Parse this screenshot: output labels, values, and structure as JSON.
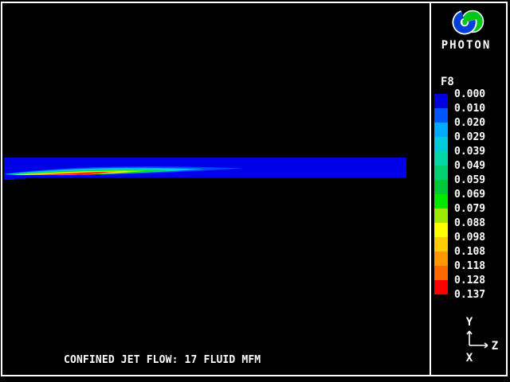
{
  "window": {
    "background": "#000000",
    "frame_color": "#ffffff"
  },
  "main": {
    "caption": "CONFINED JET FLOW: 17 FLUID MFM",
    "flow_bar": {
      "background": "#0000e8",
      "plume_layers": [
        "#0044ff",
        "#00aaff",
        "#00d0d8",
        "#00dda8",
        "#00cc44",
        "#00e800",
        "#aaee00",
        "#ffff00",
        "#ffcc00",
        "#ff8800",
        "#ff2200"
      ]
    }
  },
  "sidebar": {
    "logo_label": "PHOTON",
    "logo_colors": {
      "blue": "#0040d8",
      "green": "#00c818",
      "outline": "#ffffff"
    },
    "legend": {
      "title": "F8",
      "values": [
        "0.000",
        "0.010",
        "0.020",
        "0.029",
        "0.039",
        "0.049",
        "0.059",
        "0.069",
        "0.079",
        "0.088",
        "0.098",
        "0.108",
        "0.118",
        "0.128",
        "0.137"
      ],
      "colors": [
        "#0000e0",
        "#0055ff",
        "#00aaff",
        "#00ccd8",
        "#00d8a8",
        "#00d070",
        "#00c838",
        "#00e800",
        "#a0e800",
        "#ffff00",
        "#ffcc00",
        "#ff9800",
        "#ff6800",
        "#ff0000"
      ]
    },
    "axes": {
      "y_label": "Y",
      "z_label": "Z",
      "x_label": "X"
    }
  }
}
